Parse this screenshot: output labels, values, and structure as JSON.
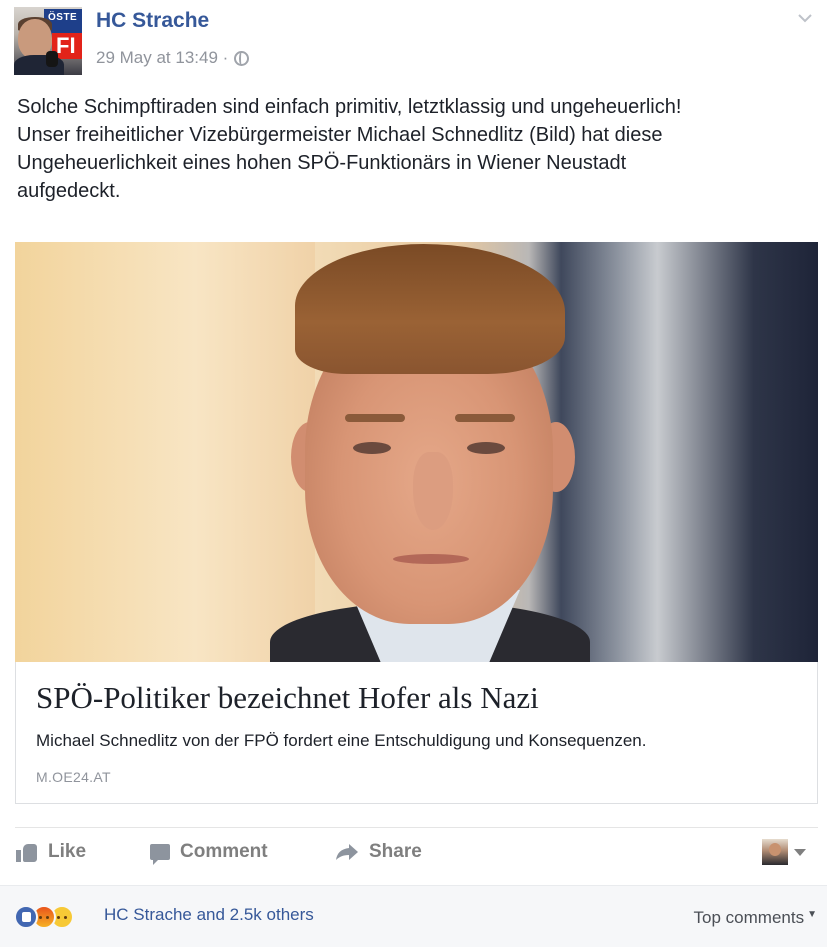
{
  "post": {
    "author": "HC Strache",
    "timestamp": "29 May at 13:49 ·",
    "privacy_icon": "globe-icon",
    "menu_icon": "chevron-down-icon",
    "text_lines": [
      "Solche Schimpftiraden sind einfach primitiv, letztklassig und ungeheuerlich!",
      "Unser freiheitlicher Vizebürgermeister Michael Schnedlitz (Bild) hat diese",
      "Ungeheuerlichkeit eines hohen SPÖ-Funktionärs in Wiener Neustadt",
      "aufgedeckt."
    ]
  },
  "avatar": {
    "banner_text": "ÖSTE",
    "banner_red_text": "FI"
  },
  "link_card": {
    "title": "SPÖ-Politiker bezeichnet Hofer als Nazi",
    "description": "Michael Schnedlitz von der FPÖ fordert eine Entschuldigung und Konsequenzen.",
    "domain": "M.OE24.AT"
  },
  "actions": {
    "like_label": "Like",
    "comment_label": "Comment",
    "share_label": "Share"
  },
  "reactions": {
    "summary": "HC Strache and 2.5k others",
    "icons": [
      "like-icon",
      "angry-icon",
      "sad-icon"
    ],
    "sort_label": "Top comments"
  },
  "colors": {
    "link_blue": "#365899",
    "meta_gray": "#90949c",
    "action_gray": "#7f7f7f",
    "reactions_bg": "#f6f7f9"
  }
}
